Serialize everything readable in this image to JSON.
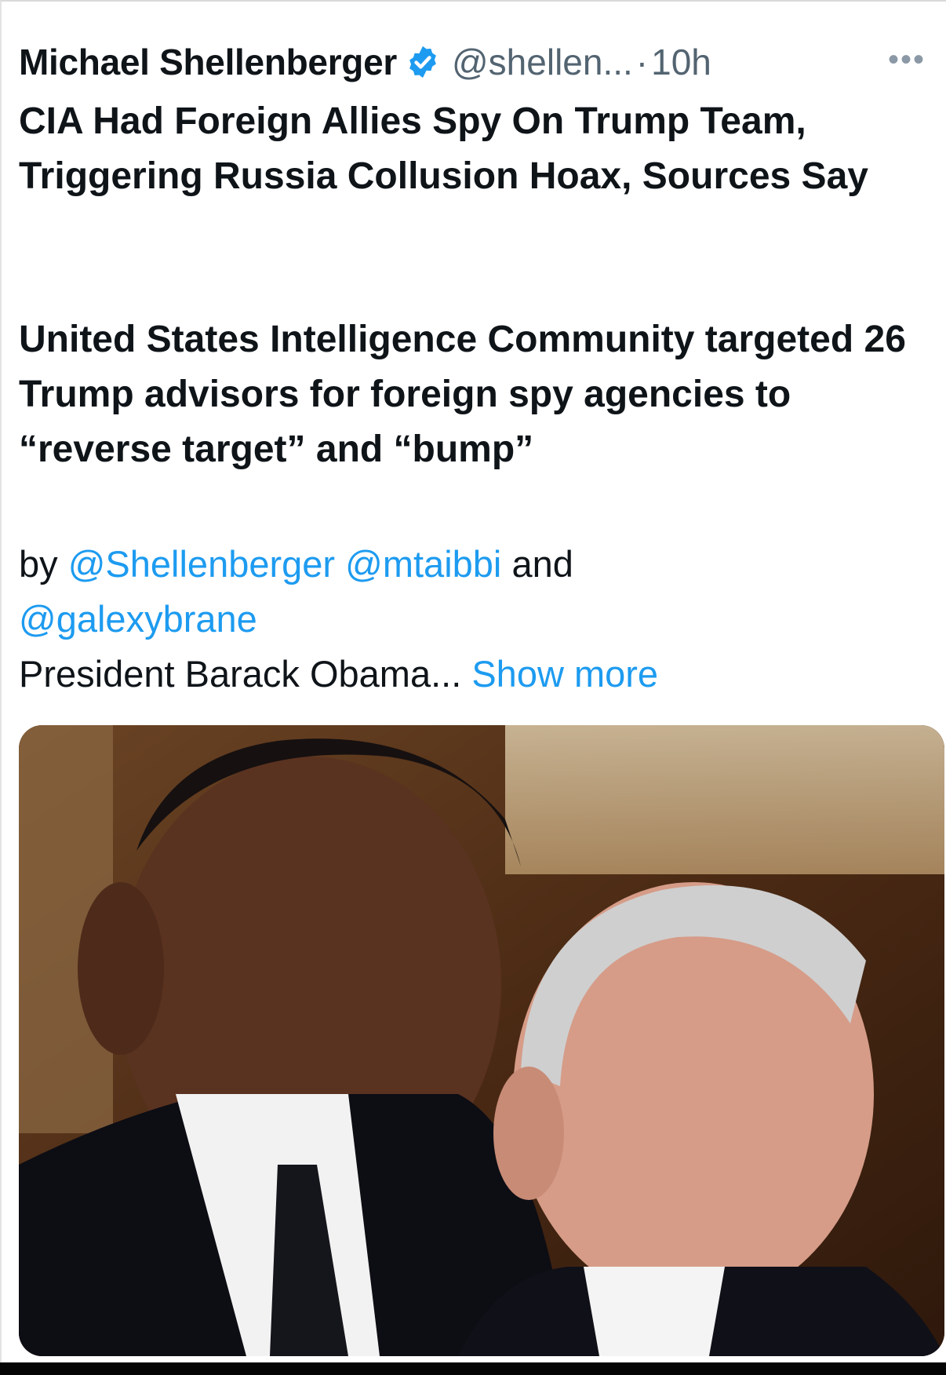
{
  "tweet": {
    "author_name": "Michael Shellenberger",
    "handle": "@shellen...",
    "separator": "·",
    "time": "10h",
    "more_icon": "ellipsis-icon",
    "verified_icon": "verified-badge-icon",
    "title": "CIA Had Foreign Allies Spy On Trump Team, Triggering Russia Collusion Hoax, Sources Say",
    "subtitle": "United States Intelligence Community targeted 26 Trump advisors for foreign spy agencies to “reverse target” and “bump”",
    "byline_prefix": "by",
    "mention_1": "@Shellenberger",
    "mention_2": "@mtaibbi",
    "byline_and": "and",
    "mention_3": "@galexybrane",
    "body_text": "President Barack Obama...",
    "show_more": "Show more"
  },
  "colors": {
    "link": "#1d9bf0",
    "text": "#0f1419",
    "muted": "#536471"
  }
}
